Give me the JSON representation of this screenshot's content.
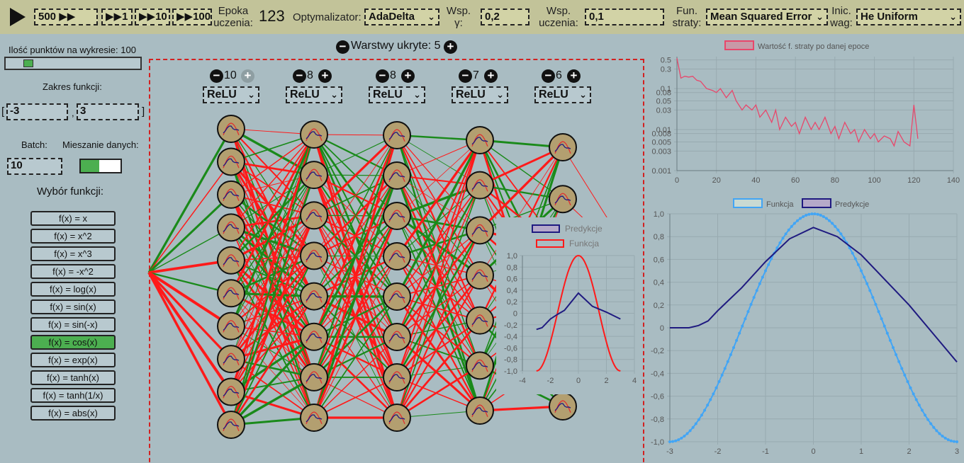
{
  "toolbar": {
    "play_icon": "play-icon",
    "step_buttons": [
      "500 ▶▶",
      "▶▶1",
      "▶▶10",
      "▶▶100"
    ],
    "epoch_label": "Epoka\nuczenia:",
    "epoch_value": "123",
    "optimizer_label": "Optymalizator:",
    "optimizer_value": "AdaDelta",
    "gamma_label": "Wsp.\nγ:",
    "gamma_value": "0,2",
    "lr_label": "Wsp.\nuczenia:",
    "lr_value": "0,1",
    "loss_label": "Fun.\nstraty:",
    "loss_value": "Mean Squared Error",
    "init_label": "Inic.\nwag:",
    "init_value": "He Uniform"
  },
  "left": {
    "points_label": "Ilość punktów na wykresie: 100",
    "points_fraction": 0.14,
    "range_label": "Zakres funkcji:",
    "range_open": "[",
    "range_sep": ",",
    "range_close": "]",
    "range_min": "-3",
    "range_max": "3",
    "batch_label": "Batch:",
    "batch_value": "10",
    "shuffle_label": "Mieszanie danych:",
    "shuffle_on": true,
    "functions_title": "Wybór funkcji:",
    "functions": [
      "f(x) = x",
      "f(x) = x^2",
      "f(x) = x^3",
      "f(x) = -x^2",
      "f(x) = log(x)",
      "f(x) = sin(x)",
      "f(x) = sin(-x)",
      "f(x) = cos(x)",
      "f(x) = exp(x)",
      "f(x) = tanh(x)",
      "f(x) = tanh(1/x)",
      "f(x) = abs(x)"
    ],
    "active_function": "f(x) = cos(x)"
  },
  "network": {
    "hidden_label": "Warstwy ukryte: 5",
    "layers": [
      {
        "count": "10",
        "activation": "ReLU"
      },
      {
        "count": "8",
        "activation": "ReLU"
      },
      {
        "count": "8",
        "activation": "ReLU"
      },
      {
        "count": "7",
        "activation": "ReLU"
      },
      {
        "count": "6",
        "activation": "ReLU"
      }
    ],
    "colors": {
      "positive": "#1a8a1a",
      "negative": "#ff1a1a",
      "neuron": "#b39f70"
    }
  },
  "popup": {
    "legend_pred": "Predykcje",
    "legend_func": "Funkcja"
  },
  "colors": {
    "accent_green": "#4caf50",
    "func_blue": "#42a5f5",
    "pred_navy": "#1f1a80",
    "loss_pink": "#e8476b"
  },
  "chart_data": [
    {
      "type": "line",
      "title": "",
      "legend": [
        "Wartość f. straty po danej epoce"
      ],
      "xlim": [
        0,
        140
      ],
      "ylim": [
        0.001,
        0.6
      ],
      "yscale": "log",
      "x_ticks": [
        "0",
        "20",
        "40",
        "60",
        "80",
        "100",
        "120",
        "140"
      ],
      "y_ticks": [
        "0.5",
        "0.3",
        "0.1",
        "0.08",
        "0.05",
        "0.03",
        "0.01",
        "0.008",
        "0.005",
        "0.003",
        "0.001"
      ],
      "series": [
        {
          "name": "Wartość f. straty po danej epoce",
          "x": [
            0,
            2,
            4,
            6,
            8,
            10,
            12,
            15,
            18,
            20,
            22,
            25,
            28,
            30,
            33,
            35,
            38,
            40,
            42,
            45,
            48,
            50,
            52,
            55,
            58,
            60,
            62,
            65,
            68,
            70,
            72,
            75,
            78,
            80,
            82,
            85,
            88,
            90,
            92,
            95,
            98,
            100,
            102,
            105,
            108,
            110,
            112,
            115,
            118,
            120,
            122
          ],
          "y": [
            0.55,
            0.18,
            0.2,
            0.19,
            0.2,
            0.16,
            0.15,
            0.1,
            0.09,
            0.08,
            0.1,
            0.06,
            0.09,
            0.05,
            0.03,
            0.04,
            0.03,
            0.04,
            0.02,
            0.03,
            0.015,
            0.03,
            0.01,
            0.02,
            0.012,
            0.015,
            0.008,
            0.02,
            0.01,
            0.015,
            0.01,
            0.02,
            0.008,
            0.012,
            0.006,
            0.015,
            0.008,
            0.01,
            0.005,
            0.01,
            0.006,
            0.008,
            0.005,
            0.007,
            0.006,
            0.004,
            0.009,
            0.005,
            0.004,
            0.04,
            0.006
          ]
        }
      ]
    },
    {
      "type": "line",
      "title": "",
      "legend": [
        "Funkcja",
        "Predykcje"
      ],
      "xlim": [
        -3,
        3
      ],
      "ylim": [
        -1,
        1
      ],
      "x_ticks": [
        "-3",
        "-2",
        "-1",
        "0",
        "1",
        "2",
        "3"
      ],
      "y_ticks": [
        "1,0",
        "0,8",
        "0,6",
        "0,4",
        "0,2",
        "0",
        "-0,2",
        "-0,4",
        "-0,6",
        "-0,8",
        "-1,0"
      ],
      "series": [
        {
          "name": "Funkcja",
          "function": "cos",
          "samples": 100
        },
        {
          "name": "Predykcje",
          "x": [
            -3,
            -2.6,
            -2.4,
            -2.2,
            -2,
            -1.5,
            -1,
            -0.5,
            0,
            0.5,
            1,
            1.5,
            2,
            2.5,
            3
          ],
          "y": [
            0,
            0,
            0.02,
            0.06,
            0.15,
            0.35,
            0.58,
            0.78,
            0.88,
            0.8,
            0.64,
            0.42,
            0.2,
            -0.05,
            -0.3
          ]
        }
      ]
    },
    {
      "type": "line",
      "title": "",
      "legend": [
        "Predykcje",
        "Funkcja"
      ],
      "xlim": [
        -4,
        4
      ],
      "ylim": [
        -1,
        1
      ],
      "x_ticks": [
        "-4",
        "-2",
        "0",
        "2",
        "4"
      ],
      "y_ticks": [
        "1,0",
        "0,8",
        "0,6",
        "0,4",
        "0,2",
        "0",
        "-0,2",
        "-0,4",
        "-0,6",
        "-0,8",
        "-1,0"
      ],
      "series": [
        {
          "name": "Predykcje",
          "x": [
            -3,
            -2.6,
            -2,
            -1.5,
            -1,
            0,
            1,
            2,
            3
          ],
          "y": [
            -0.28,
            -0.25,
            -0.1,
            -0.02,
            0.05,
            0.35,
            0.12,
            0.02,
            -0.1
          ]
        },
        {
          "name": "Funkcja",
          "function": "cos",
          "samples": 60
        }
      ]
    }
  ]
}
